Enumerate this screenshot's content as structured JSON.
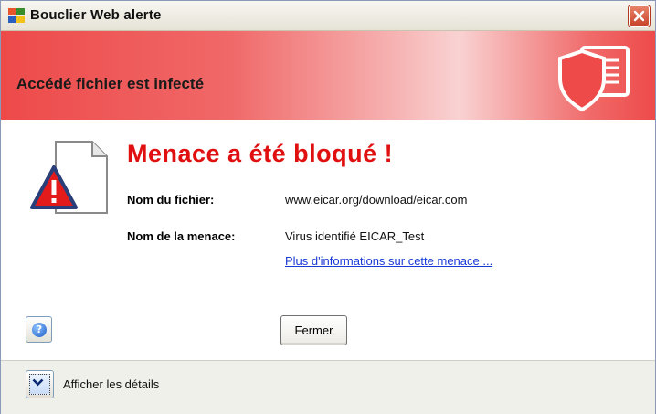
{
  "window": {
    "title": "Bouclier Web alerte"
  },
  "banner": {
    "text": "Accédé fichier est infecté"
  },
  "content": {
    "headline": "Menace a été bloqué !",
    "file_label": "Nom du fichier:",
    "file_value": "www.eicar.org/download/eicar.com",
    "threat_label": "Nom de la menace:",
    "threat_value": "Virus identifié EICAR_Test",
    "more_info_link": "Plus d'informations sur cette menace ..."
  },
  "buttons": {
    "close_label": "Fermer",
    "help_glyph": "?"
  },
  "footer": {
    "details_label": "Afficher les détails"
  },
  "colors": {
    "banner": "#ee4a4a",
    "headline": "#e01010",
    "link": "#1a3ad6"
  },
  "icons": [
    "app-icon",
    "close-icon",
    "shield-icon",
    "warning-document-icon",
    "help-icon",
    "chevron-down-icon"
  ]
}
